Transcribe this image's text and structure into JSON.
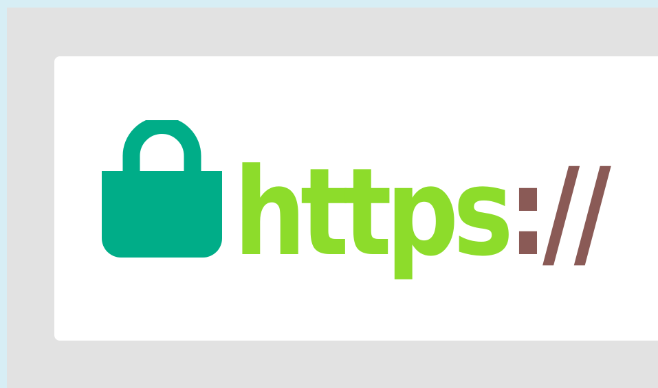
{
  "url_display": {
    "scheme": "https",
    "colon": ":",
    "slashes": "//"
  },
  "icons": {
    "lock": "lock-icon"
  },
  "colors": {
    "page_background": "#d7eef5",
    "frame": "#e2e2e2",
    "bar": "#ffffff",
    "lock": "#00ad88",
    "scheme_text": "#8ddc2b",
    "separator_text": "#8a5a56"
  }
}
